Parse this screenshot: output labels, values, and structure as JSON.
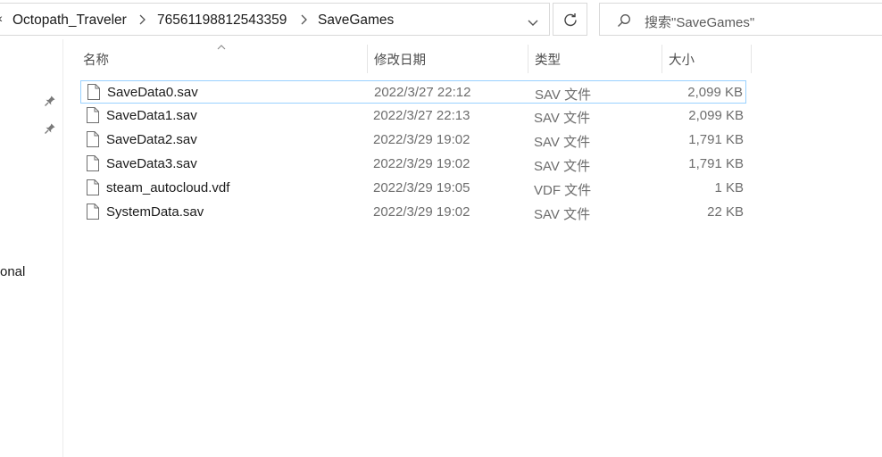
{
  "breadcrumb": {
    "overflow": "«",
    "items": [
      "Octopath_Traveler",
      "76561198812543359",
      "SaveGames"
    ]
  },
  "search": {
    "placeholder": "搜索\"SaveGames\""
  },
  "nav": {
    "partial_label": "onal"
  },
  "columns": {
    "name": "名称",
    "date": "修改日期",
    "type": "类型",
    "size": "大小"
  },
  "files": [
    {
      "name": "SaveData0.sav",
      "date": "2022/3/27 22:12",
      "type": "SAV 文件",
      "size": "2,099 KB",
      "selected": true
    },
    {
      "name": "SaveData1.sav",
      "date": "2022/3/27 22:13",
      "type": "SAV 文件",
      "size": "2,099 KB",
      "selected": false
    },
    {
      "name": "SaveData2.sav",
      "date": "2022/3/29 19:02",
      "type": "SAV 文件",
      "size": "1,791 KB",
      "selected": false
    },
    {
      "name": "SaveData3.sav",
      "date": "2022/3/29 19:02",
      "type": "SAV 文件",
      "size": "1,791 KB",
      "selected": false
    },
    {
      "name": "steam_autocloud.vdf",
      "date": "2022/3/29 19:05",
      "type": "VDF 文件",
      "size": "1 KB",
      "selected": false
    },
    {
      "name": "SystemData.sav",
      "date": "2022/3/29 19:02",
      "type": "SAV 文件",
      "size": "22 KB",
      "selected": false
    }
  ],
  "colors": {
    "selection_border": "#99d1ff",
    "border": "#d9d9d9",
    "secondary_text": "#6d6d6d"
  }
}
